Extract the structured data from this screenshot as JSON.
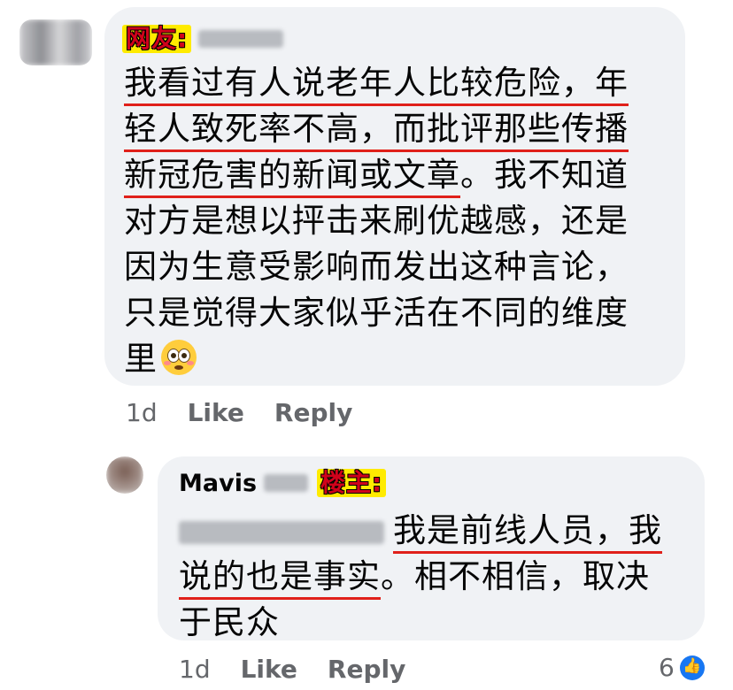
{
  "comment1": {
    "tag": "网友:",
    "lines": [
      [
        "我看过有人说老年人比较危险，年",
        ""
      ],
      [
        "轻人致死率不高，而批评那些传播",
        ""
      ],
      [
        "新冠危害的新闻或文章",
        "。我不知道"
      ],
      [
        "",
        "对方是想以抨击来刷优越感，还是"
      ],
      [
        "",
        "因为生意受影响而发出这种言论，"
      ],
      [
        "",
        "只是觉得大家似乎活在不同的维度"
      ],
      [
        "",
        "里"
      ]
    ],
    "emoji": "flushed-face",
    "time": "1d",
    "like": "Like",
    "reply": "Reply"
  },
  "comment2": {
    "name": "Mavis",
    "tag": "楼主:",
    "line1": "我是前线人员，我",
    "line2_ul": "说的也是事实",
    "line2_rest": "。相不相信，取决",
    "line3": "于民众",
    "time": "1d",
    "like": "Like",
    "reply": "Reply",
    "like_count": "6"
  },
  "colors": {
    "bubble": "#f0f2f5",
    "underline": "#e0201a",
    "tag_bg": "#ffeb00",
    "tag_text": "#d0021b",
    "like_blue": "#1877f2"
  }
}
